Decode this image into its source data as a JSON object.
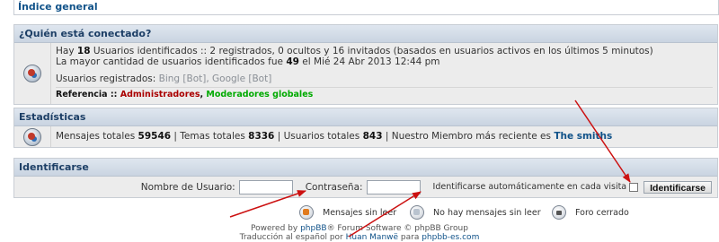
{
  "nav": {
    "index_label": "Índice general"
  },
  "who": {
    "title": "¿Quién está conectado?",
    "line1_pre": "Hay ",
    "line1_count": "18",
    "line1_post": " Usuarios identificados :: 2 registrados, 0 ocultos y 16 invitados (basados en usuarios activos en los últimos 5 minutos)",
    "line2_pre": "La mayor cantidad de usuarios identificados fue ",
    "line2_count": "49",
    "line2_post": " el Mié 24 Abr 2013 12:44 pm",
    "registered_label": "Usuarios registrados: ",
    "bots": "Bing [Bot], Google [Bot]",
    "legend_label": "Referencia :: ",
    "legend_admin": "Administradores",
    "legend_sep": ", ",
    "legend_gmod": "Moderadores globales"
  },
  "stats": {
    "title": "Estadísticas",
    "posts_label": "Mensajes totales ",
    "posts_value": "59546",
    "topics_label": " | Temas totales ",
    "topics_value": "8336",
    "users_label": " | Usuarios totales ",
    "users_value": "843",
    "newest_label": " | Nuestro Miembro más reciente es ",
    "newest_value": "The smiths"
  },
  "login": {
    "title": "Identificarse",
    "username_label": "Nombre de Usuario:",
    "username_value": "",
    "password_label": "Contraseña:",
    "password_value": "",
    "autologin_label": "Identificarse automáticamente en cada visita",
    "autologin_checked": false,
    "submit_label": "Identificarse"
  },
  "legend": {
    "unread": "Mensajes sin leer",
    "read": "No hay mensajes sin leer",
    "locked": "Foro cerrado"
  },
  "footer": {
    "line1_pre": "Powered by ",
    "line1_link": "phpBB",
    "line1_post": "® Forum Software © phpBB Group",
    "line2_pre": "Traducción al español por ",
    "line2_link1": "Huan Manwë",
    "line2_mid": " para ",
    "line2_link2": "phpbb-es.com"
  },
  "colors": {
    "header_text": "#1d3f66",
    "link": "#105289",
    "admin": "#aa0000",
    "global_mod": "#00aa00",
    "annotation_arrow": "#cc1111"
  }
}
